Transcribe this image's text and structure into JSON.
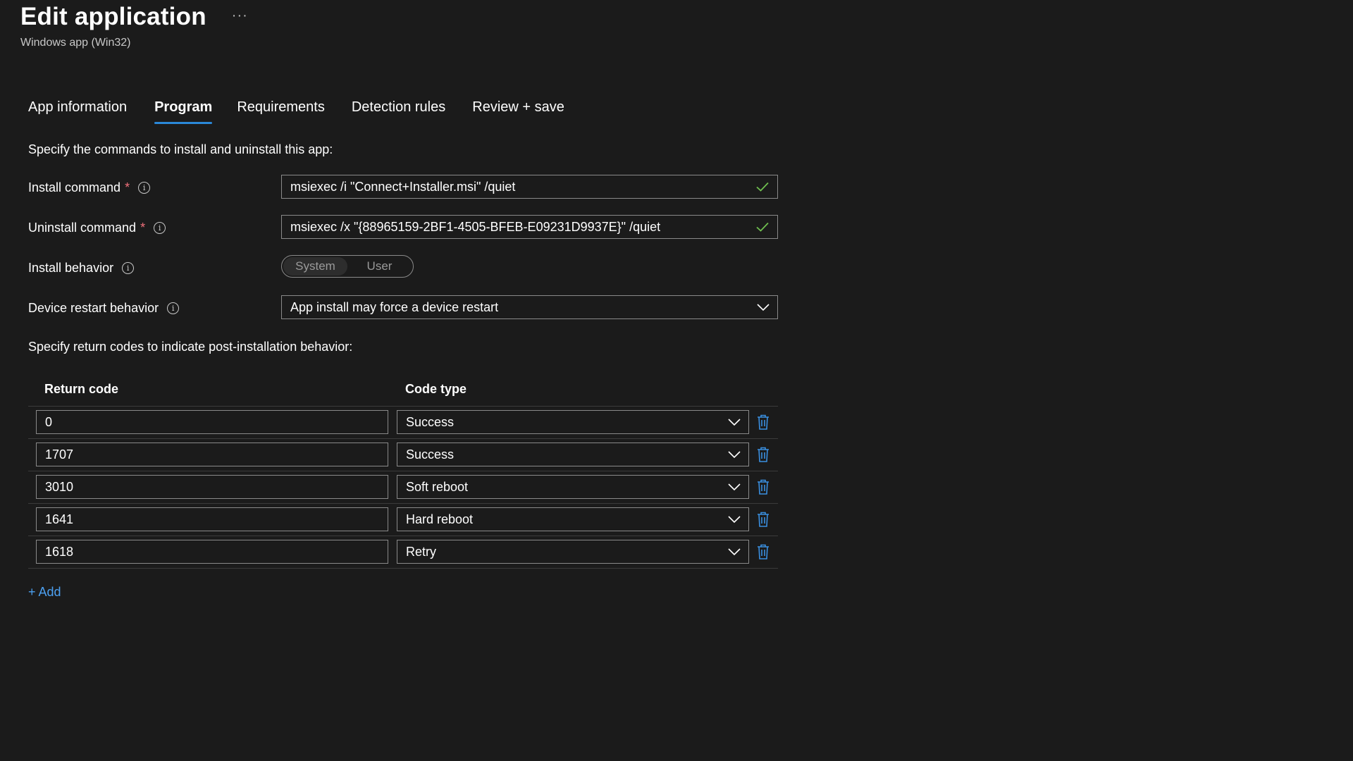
{
  "header": {
    "title": "Edit application",
    "more": "···",
    "subtitle": "Windows app (Win32)"
  },
  "tabs": [
    {
      "label": "App information",
      "active": false
    },
    {
      "label": "Program",
      "active": true
    },
    {
      "label": "Requirements",
      "active": false
    },
    {
      "label": "Detection rules",
      "active": false
    },
    {
      "label": "Review + save",
      "active": false
    }
  ],
  "commands_intro": "Specify the commands to install and uninstall this app:",
  "install_command": {
    "label": "Install command",
    "required_mark": "*",
    "value": "msiexec /i \"Connect+Installer.msi\" /quiet",
    "valid": true
  },
  "uninstall_command": {
    "label": "Uninstall command",
    "required_mark": "*",
    "value": "msiexec /x \"{88965159-2BF1-4505-BFEB-E09231D9937E}\" /quiet",
    "valid": true
  },
  "install_behavior": {
    "label": "Install behavior",
    "options": [
      "System",
      "User"
    ],
    "selected": "System"
  },
  "device_restart": {
    "label": "Device restart behavior",
    "value": "App install may force a device restart"
  },
  "return_codes_intro": "Specify return codes to indicate post-installation behavior:",
  "return_codes": {
    "header_code": "Return code",
    "header_type": "Code type",
    "rows": [
      {
        "code": "0",
        "type": "Success"
      },
      {
        "code": "1707",
        "type": "Success"
      },
      {
        "code": "3010",
        "type": "Soft reboot"
      },
      {
        "code": "1641",
        "type": "Hard reboot"
      },
      {
        "code": "1618",
        "type": "Retry"
      }
    ]
  },
  "add_label": "+ Add",
  "colors": {
    "background": "#1b1b1b",
    "accent": "#2b88d8",
    "link": "#4ca0f0",
    "valid_check": "#6fbf4f",
    "required": "#f1707b",
    "delete_icon": "#3a8fe0"
  },
  "icons": {
    "info": "info-icon",
    "check": "checkmark-icon",
    "chevron": "chevron-down-icon",
    "delete": "trash-icon"
  }
}
